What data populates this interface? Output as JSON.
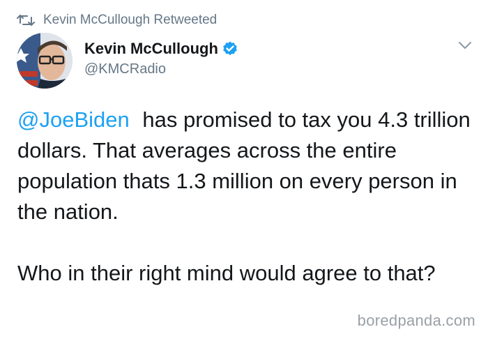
{
  "retweet": {
    "icon": "retweet-icon",
    "label": "Kevin McCullough Retweeted"
  },
  "author": {
    "display_name": "Kevin McCullough",
    "handle": "@KMCRadio",
    "verified_icon": "verified-badge-icon",
    "verified_color": "#1da1f2"
  },
  "menu": {
    "icon": "chevron-down-icon"
  },
  "tweet": {
    "mention": "@JoeBiden",
    "paragraph1_rest": "has promised to tax you 4.3 trillion dollars. That averages across the entire population thats 1.3 million on every person in the nation.",
    "paragraph2": "Who in their right mind would agree to that?"
  },
  "watermark": "boredpanda.com",
  "colors": {
    "text": "#14171a",
    "secondary": "#657786",
    "link": "#1da1f2"
  }
}
